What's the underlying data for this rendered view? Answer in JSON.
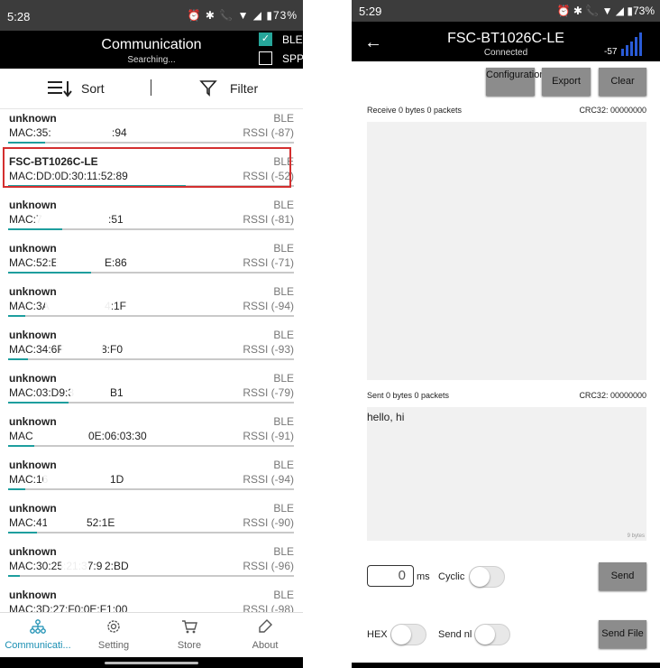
{
  "left": {
    "status": {
      "time": "5:28",
      "icons": "⏰ ✱ 📞 ▼ ◢ ▮73%"
    },
    "appbar": {
      "title": "Communication",
      "subtitle": "Searching...",
      "ble_label": "BLE",
      "spp_label": "SPP",
      "ble_checked": true,
      "spp_checked": false
    },
    "sortbar": {
      "sort_label": "Sort",
      "filter_label": "Filter"
    },
    "devices": [
      {
        "name": "unknown",
        "mac": "MAC:35:",
        "mac_tail": ":94",
        "type": "BLE",
        "rssi": "RSSI (-87)",
        "signal": 0.13
      },
      {
        "name": "FSC-BT1026C-LE",
        "mac": "MAC:DD:0D:30:11:52:89",
        "mac_tail": "",
        "type": "BLE",
        "rssi": "RSSI (-52)",
        "signal": 0.62
      },
      {
        "name": "unknown",
        "mac": "MAC:7",
        "mac_tail": ":51",
        "type": "BLE",
        "rssi": "RSSI (-81)",
        "signal": 0.19
      },
      {
        "name": "unknown",
        "mac": "MAC:52:E",
        "mac_tail": "E:86",
        "type": "BLE",
        "rssi": "RSSI (-71)",
        "signal": 0.29
      },
      {
        "name": "unknown",
        "mac": "MAC:3A",
        "mac_tail": "4:1F",
        "type": "BLE",
        "rssi": "RSSI (-94)",
        "signal": 0.06
      },
      {
        "name": "unknown",
        "mac": "MAC:34:6F",
        "mac_tail": "8:F0",
        "type": "BLE",
        "rssi": "RSSI (-93)",
        "signal": 0.07
      },
      {
        "name": "unknown",
        "mac": "MAC:03:D9:3",
        "mac_tail": "B1",
        "type": "BLE",
        "rssi": "RSSI (-79)",
        "signal": 0.21
      },
      {
        "name": "unknown",
        "mac": "MAC",
        "mac_tail": "0E:06:03:30",
        "type": "BLE",
        "rssi": "RSSI (-91)",
        "signal": 0.09
      },
      {
        "name": "unknown",
        "mac": "MAC:16",
        "mac_tail": "1D",
        "type": "BLE",
        "rssi": "RSSI (-94)",
        "signal": 0.06
      },
      {
        "name": "unknown",
        "mac": "MAC:41",
        "mac_tail": "52:1E",
        "type": "BLE",
        "rssi": "RSSI (-90)",
        "signal": 0.1
      },
      {
        "name": "unknown",
        "mac": "MAC:30:25:21:37:9",
        "mac_tail": "2:BD",
        "type": "BLE",
        "rssi": "RSSI (-96)",
        "signal": 0.04
      },
      {
        "name": "unknown",
        "mac": "MAC:3D:27:F0:0E:F1:00",
        "mac_tail": "",
        "type": "BLE",
        "rssi": "RSSI (-98)",
        "signal": 0.02
      }
    ],
    "bottom_nav": [
      "Communicati...",
      "Setting",
      "Store",
      "About"
    ]
  },
  "right": {
    "status": {
      "time": "5:29",
      "icons": "⏰ ✱ 📞 ▼ ◢ ▮73%"
    },
    "appbar": {
      "title": "FSC-BT1026C-LE",
      "subtitle": "Connected",
      "rssi": "-57"
    },
    "buttons": {
      "config": "Configuration",
      "export": "Export",
      "clear": "Clear"
    },
    "receive": {
      "label": "Receive 0 bytes 0 packets",
      "crc": "CRC32: 00000000"
    },
    "sent": {
      "label": "Sent 0 bytes 0 packets",
      "crc": "CRC32: 00000000",
      "text": "hello, hi",
      "bytes": "9 bytes"
    },
    "controls": {
      "interval": "0",
      "ms": "ms",
      "cyclic": "Cyclic",
      "send": "Send",
      "hex": "HEX",
      "send_nl": "Send nl",
      "send_file": "Send File"
    }
  }
}
